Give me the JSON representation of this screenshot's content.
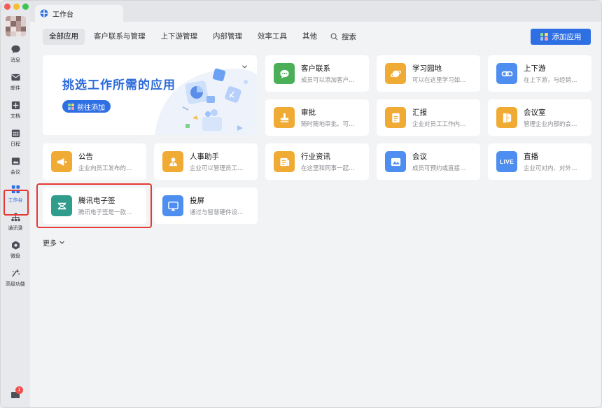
{
  "window": {
    "tab_title": "工作台"
  },
  "sidebar": {
    "items": [
      {
        "label": "消息",
        "icon": "chat-bubble-icon"
      },
      {
        "label": "邮件",
        "icon": "mail-icon"
      },
      {
        "label": "文档",
        "icon": "document-icon"
      },
      {
        "label": "日程",
        "icon": "calendar-icon"
      },
      {
        "label": "会议",
        "icon": "meeting-icon"
      },
      {
        "label": "工作台",
        "icon": "workbench-grid-icon",
        "active": true
      },
      {
        "label": "通讯录",
        "icon": "contacts-org-icon"
      },
      {
        "label": "微盘",
        "icon": "drive-icon"
      },
      {
        "label": "高级功能",
        "icon": "sparkle-icon"
      }
    ],
    "notification_badge": "1"
  },
  "tabs": [
    {
      "label": "全部应用",
      "active": true
    },
    {
      "label": "客户联系与管理"
    },
    {
      "label": "上下游管理"
    },
    {
      "label": "内部管理"
    },
    {
      "label": "效率工具"
    },
    {
      "label": "其他"
    }
  ],
  "search_label": "搜索",
  "add_button_label": "添加应用",
  "banner": {
    "title": "挑选工作所需的应用",
    "button_label": "前往添加"
  },
  "apps": [
    {
      "key": "customer",
      "name": "客户联系",
      "desc": "成员可以添加客户…",
      "color": "#4aaf57",
      "icon": "chat-dots-icon"
    },
    {
      "key": "learning",
      "name": "学习园地",
      "desc": "可以在这里学习如…",
      "color": "#f0ab35",
      "icon": "planet-icon"
    },
    {
      "key": "updown",
      "name": "上下游",
      "desc": "在上下游，与经销…",
      "color": "#4d8ef0",
      "icon": "chain-link-icon"
    },
    {
      "key": "approval",
      "name": "审批",
      "desc": "随时随地审批。可…",
      "color": "#f0ab35",
      "icon": "stamp-icon"
    },
    {
      "key": "report",
      "name": "汇报",
      "desc": "企业对员工工作内…",
      "color": "#f0ab35",
      "icon": "report-doc-icon"
    },
    {
      "key": "room",
      "name": "会议室",
      "desc": "管理企业内部的会…",
      "color": "#f0ab35",
      "icon": "door-icon"
    },
    {
      "key": "notice",
      "name": "公告",
      "desc": "企业向员工发布的…",
      "color": "#f0ab35",
      "icon": "megaphone-icon"
    },
    {
      "key": "hr",
      "name": "人事助手",
      "desc": "企业可以管理员工…",
      "color": "#f0ab35",
      "icon": "person-icon"
    },
    {
      "key": "news",
      "name": "行业资讯",
      "desc": "在这里和同事一起…",
      "color": "#f0ab35",
      "icon": "news-icon"
    },
    {
      "key": "meeting",
      "name": "会议",
      "desc": "成员可预约或直接…",
      "color": "#4d8ef0",
      "icon": "meeting-icon"
    },
    {
      "key": "live",
      "name": "直播",
      "desc": "企业可对内、对外…",
      "color": "#4d8ef0",
      "icon": "live-icon",
      "icon_text": "LIVE"
    },
    {
      "key": "esign",
      "name": "腾讯电子签",
      "desc": "腾讯电子签是一款…",
      "color": "#2f9c8c",
      "icon": "esign-icon"
    },
    {
      "key": "cast",
      "name": "投屏",
      "desc": "通过与智慧硬件设…",
      "color": "#4d8ef0",
      "icon": "screen-cast-icon"
    }
  ],
  "more_label": "更多"
}
